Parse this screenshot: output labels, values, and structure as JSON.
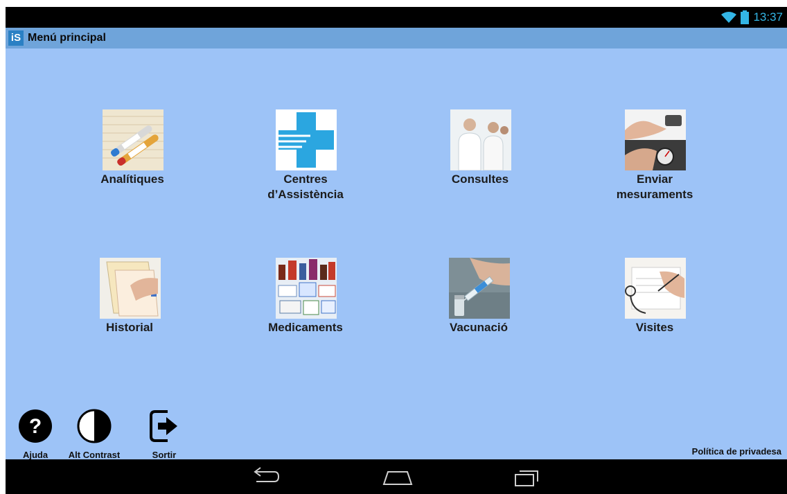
{
  "status_bar": {
    "time": "13:37",
    "wifi_icon": "wifi-icon",
    "battery_icon": "battery-icon"
  },
  "action_bar": {
    "logo_text": "iS",
    "title": "Menú principal"
  },
  "menu": {
    "items": [
      {
        "label": "Analítiques",
        "icon": "lab-tubes-icon"
      },
      {
        "label": "Centres\nd’Assistència",
        "icon": "medical-cross-icon"
      },
      {
        "label": "Consultes",
        "icon": "doctors-icon"
      },
      {
        "label": "Enviar\nmesuraments",
        "icon": "measurements-icon"
      },
      {
        "label": "Historial",
        "icon": "medical-record-icon"
      },
      {
        "label": "Medicaments",
        "icon": "medicines-icon"
      },
      {
        "label": "Vacunació",
        "icon": "syringe-icon"
      },
      {
        "label": "Visites",
        "icon": "appointment-icon"
      }
    ]
  },
  "bottom_bar": {
    "help_label": "Ajuda",
    "help_glyph": "?",
    "contrast_label": "Alt Contrast",
    "exit_label": "Sortir",
    "privacy_label": "Política de privadesa"
  },
  "colors": {
    "content_bg": "#9dc3f7",
    "action_bar_bg": "#6fa4da",
    "status_accent": "#33b5e5",
    "cross_blue": "#2ba6e0"
  }
}
